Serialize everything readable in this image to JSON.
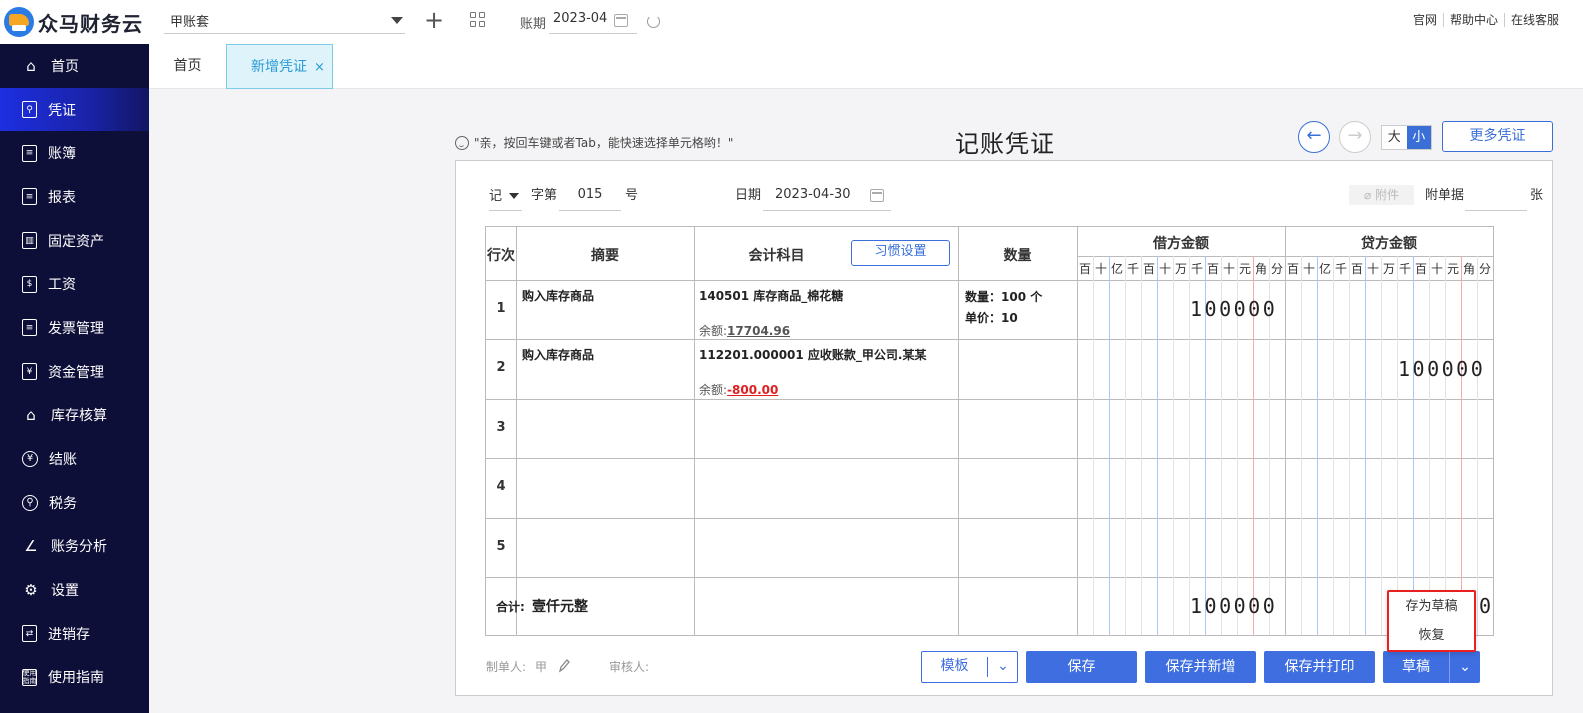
{
  "app": {
    "name": "众马财务云"
  },
  "topbar": {
    "account_set": "甲账套",
    "period_label": "账期",
    "period_value": "2023-04",
    "links": [
      "官网",
      "帮助中心",
      "在线客服"
    ]
  },
  "sidebar": {
    "items": [
      {
        "label": "首页",
        "icon": "home-icon"
      },
      {
        "label": "凭证",
        "icon": "voucher-search-icon",
        "active": true
      },
      {
        "label": "账簿",
        "icon": "ledger-icon"
      },
      {
        "label": "报表",
        "icon": "clipboard-icon"
      },
      {
        "label": "固定资产",
        "icon": "building-icon"
      },
      {
        "label": "工资",
        "icon": "salary-icon"
      },
      {
        "label": "发票管理",
        "icon": "invoice-icon"
      },
      {
        "label": "资金管理",
        "icon": "yen-box-icon"
      },
      {
        "label": "库存核算",
        "icon": "warehouse-icon"
      },
      {
        "label": "结账",
        "icon": "yen-circle-icon"
      },
      {
        "label": "税务",
        "icon": "tax-icon"
      },
      {
        "label": "账务分析",
        "icon": "line-chart-icon"
      },
      {
        "label": "设置",
        "icon": "gear-icon"
      },
      {
        "label": "进销存",
        "icon": "transfer-icon"
      },
      {
        "label": "使用指南",
        "icon": "guide-icon",
        "icon_text": "使用\n指南"
      }
    ]
  },
  "tabs": {
    "home": "首页",
    "current": "新增凭证",
    "close": "×"
  },
  "voucher": {
    "tip": "\"亲，按回车键或者Tab，能快速选择单元格哟！\"",
    "title": "记账凭证",
    "size_big": "大",
    "size_small": "小",
    "more_button": "更多凭证",
    "type": "记",
    "word_label": "字第",
    "number": "015",
    "number_suffix": "号",
    "date_label": "日期",
    "date": "2023-04-30",
    "attachment_button": "附件",
    "attach_docs_label": "附单据",
    "attach_docs_count": "",
    "attach_docs_suffix": "张"
  },
  "table": {
    "headers": {
      "row": "行次",
      "summary": "摘要",
      "account": "会计科目",
      "habit_button": "习惯设置",
      "quantity": "数量",
      "debit": "借方金额",
      "credit": "贷方金额"
    },
    "digit_units": [
      "百",
      "十",
      "亿",
      "千",
      "百",
      "十",
      "万",
      "千",
      "百",
      "十",
      "元",
      "角",
      "分"
    ],
    "rows": [
      {
        "no": "1",
        "summary": "购入库存商品",
        "account": "140501 库存商品_棉花糖",
        "balance_label": "余额:",
        "balance": "17704.96",
        "qty_line1": "数量：100 个",
        "qty_line2": "单价：10",
        "debit": "100000",
        "credit": ""
      },
      {
        "no": "2",
        "summary": "购入库存商品",
        "account": "112201.000001 应收账款_甲公司.某某",
        "balance_label": "余额:",
        "balance": "-800.00",
        "qty_line1": "",
        "qty_line2": "",
        "debit": "",
        "credit": "100000"
      },
      {
        "no": "3",
        "summary": "",
        "account": "",
        "balance_label": "",
        "balance": "",
        "qty_line1": "",
        "qty_line2": "",
        "debit": "",
        "credit": ""
      },
      {
        "no": "4",
        "summary": "",
        "account": "",
        "balance_label": "",
        "balance": "",
        "qty_line1": "",
        "qty_line2": "",
        "debit": "",
        "credit": ""
      },
      {
        "no": "5",
        "summary": "",
        "account": "",
        "balance_label": "",
        "balance": "",
        "qty_line1": "",
        "qty_line2": "",
        "debit": "",
        "credit": ""
      }
    ],
    "total_label": "合计:",
    "total_words": "壹仟元整",
    "total_debit": "100000",
    "total_credit_visible": "0"
  },
  "footer": {
    "maker_label": "制单人:",
    "maker": "甲",
    "reviewer_label": "审核人:",
    "template_button": "模板",
    "save_button": "保存",
    "save_new_button": "保存并新增",
    "save_print_button": "保存并打印",
    "draft_button": "草稿",
    "draft_menu": [
      "存为草稿",
      "恢复"
    ]
  },
  "colors": {
    "sidebar_bg": "#0e0f38",
    "accent": "#3e6ee0",
    "danger": "#e02020",
    "highlight_border": "#e82020"
  }
}
